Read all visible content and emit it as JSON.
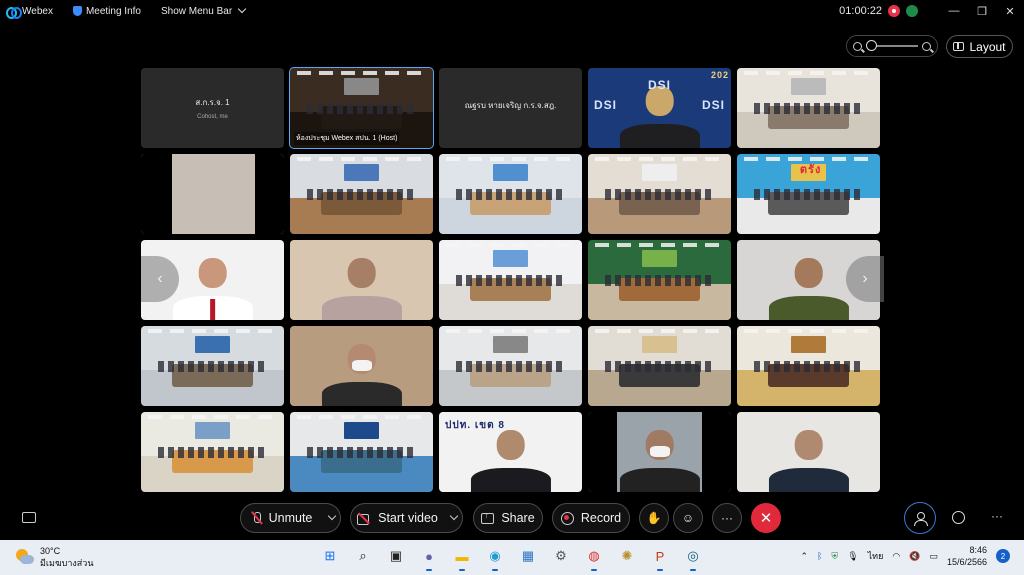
{
  "titlebar": {
    "app_name": "Webex",
    "meeting_info": "Meeting Info",
    "show_menu_bar": "Show Menu Bar",
    "timer": "01:00:22"
  },
  "window_controls": {
    "minimize": "—",
    "maximize": "❐",
    "close": "✕"
  },
  "view": {
    "layout_label": "Layout"
  },
  "tiles": [
    {
      "type": "placeholder",
      "name": "ส.ก.ร.จ. 1",
      "sub": "Cohost, me"
    },
    {
      "type": "room",
      "caption": "ห้องประชุม Webex สปน. 1 (Host)",
      "active": true,
      "palette": [
        "#3a2c20",
        "#1c140e",
        "#211a14",
        "#888"
      ]
    },
    {
      "type": "placeholder",
      "name": "ณฐรบ หายเจริญ ก.ร.จ.สฎ.",
      "sub": ""
    },
    {
      "type": "person-banner",
      "text": "DSI",
      "year": "202",
      "palette": [
        "#1b3a7a",
        "#c9a86a",
        "#1f1f22"
      ]
    },
    {
      "type": "room",
      "caption": "",
      "palette": [
        "#e8e4dc",
        "#cfc8bc",
        "#8a7a6c",
        "#bbb"
      ]
    },
    {
      "type": "person-side",
      "palette": [
        "#c7bfb5",
        "#c7bfb5",
        "#d8d0c6"
      ]
    },
    {
      "type": "room",
      "caption": "",
      "palette": [
        "#d9dde2",
        "#a77c52",
        "#7b5a3a",
        "#4a78b8"
      ]
    },
    {
      "type": "room",
      "caption": "",
      "palette": [
        "#dfe4ea",
        "#cdd6df",
        "#c8a378",
        "#5090d0"
      ]
    },
    {
      "type": "room",
      "caption": "",
      "palette": [
        "#e3ddd3",
        "#b89a7a",
        "#7a6250",
        "#eeeeee"
      ]
    },
    {
      "type": "banner-room",
      "text": "ตรัง",
      "palette": [
        "#3aa3d8",
        "#e9e9ea",
        "#5a5a5a",
        "#e8c24a"
      ]
    },
    {
      "type": "person",
      "palette": [
        "#f2f2f2",
        "#c9977c",
        "#ffffff",
        "#1b1b1b"
      ],
      "tie": true
    },
    {
      "type": "person",
      "palette": [
        "#d8c6b0",
        "#a77f66",
        "#b8a2a0",
        "#000"
      ]
    },
    {
      "type": "room",
      "caption": "",
      "palette": [
        "#f2f2f5",
        "#dfdcd7",
        "#a78056",
        "#6a9ed8"
      ]
    },
    {
      "type": "room",
      "caption": "",
      "palette": [
        "#2a6a3c",
        "#c9b8a0",
        "#a06a3a",
        "#78b04a"
      ]
    },
    {
      "type": "person",
      "palette": [
        "#d8d6d4",
        "#a57a5c",
        "#4a5a2a",
        "#000"
      ]
    },
    {
      "type": "room",
      "caption": "",
      "palette": [
        "#d6dbe0",
        "#c0c6cc",
        "#7a6a58",
        "#3a70b0"
      ]
    },
    {
      "type": "person",
      "palette": [
        "#b89c80",
        "#b48a70",
        "#2a2a2a",
        "#000"
      ],
      "mask": true
    },
    {
      "type": "room",
      "caption": "",
      "palette": [
        "#e6e8ea",
        "#c5c8cb",
        "#b9a48a",
        "#888"
      ]
    },
    {
      "type": "room",
      "caption": "",
      "palette": [
        "#e2ddd4",
        "#b8a890",
        "#3a3a3a",
        "#d8c090"
      ]
    },
    {
      "type": "room",
      "caption": "",
      "palette": [
        "#ece7dc",
        "#d4b46a",
        "#5a3a2a",
        "#b07a3a"
      ]
    },
    {
      "type": "room",
      "caption": "",
      "palette": [
        "#eaeae2",
        "#d9d4c6",
        "#d89a4a",
        "#7aa0c8"
      ]
    },
    {
      "type": "room",
      "caption": "",
      "palette": [
        "#e6e8ea",
        "#4a8ac0",
        "#3b6e8c",
        "#1c4a8a"
      ]
    },
    {
      "type": "person-banner2",
      "text": "ปปท. เขต 8",
      "palette": [
        "#f2f2f2",
        "#b08a6c",
        "#1b1b1f"
      ]
    },
    {
      "type": "person",
      "palette": [
        "#9aa3aa",
        "#a07a62",
        "#222",
        "#000"
      ],
      "mask": true,
      "sides": true
    },
    {
      "type": "person",
      "palette": [
        "#e8e6e2",
        "#b08a70",
        "#1f2a3a",
        "#000"
      ]
    }
  ],
  "controls": {
    "unmute": "Unmute",
    "start_video": "Start video",
    "share": "Share",
    "record": "Record",
    "more": "···",
    "end": "✕"
  },
  "taskbar": {
    "weather_temp": "30°C",
    "weather_desc": "มีเมฆบางส่วน",
    "lang": "ไทย",
    "time": "8:46",
    "date": "15/6/2566",
    "notifications": "2",
    "apps": [
      {
        "name": "windows-start-icon",
        "glyph": "⊞",
        "color": "#1a73e8"
      },
      {
        "name": "search-icon",
        "glyph": "⌕",
        "color": "#222"
      },
      {
        "name": "task-view-icon",
        "glyph": "▣",
        "color": "#222"
      },
      {
        "name": "teams-chat-icon",
        "glyph": "●",
        "color": "#6264a7"
      },
      {
        "name": "file-explorer-icon",
        "glyph": "▬",
        "color": "#f2b700"
      },
      {
        "name": "edge-icon",
        "glyph": "◉",
        "color": "#1f9bd1"
      },
      {
        "name": "store-icon",
        "glyph": "▦",
        "color": "#2b73c9"
      },
      {
        "name": "settings-icon",
        "glyph": "⚙",
        "color": "#555"
      },
      {
        "name": "chrome-icon",
        "glyph": "◍",
        "color": "#d93025"
      },
      {
        "name": "seal-app-icon",
        "glyph": "✺",
        "color": "#b8902a"
      },
      {
        "name": "powerpoint-icon",
        "glyph": "P",
        "color": "#c43e1c"
      },
      {
        "name": "webex-taskbar-icon",
        "glyph": "◎",
        "color": "#0c5a7a"
      }
    ]
  }
}
